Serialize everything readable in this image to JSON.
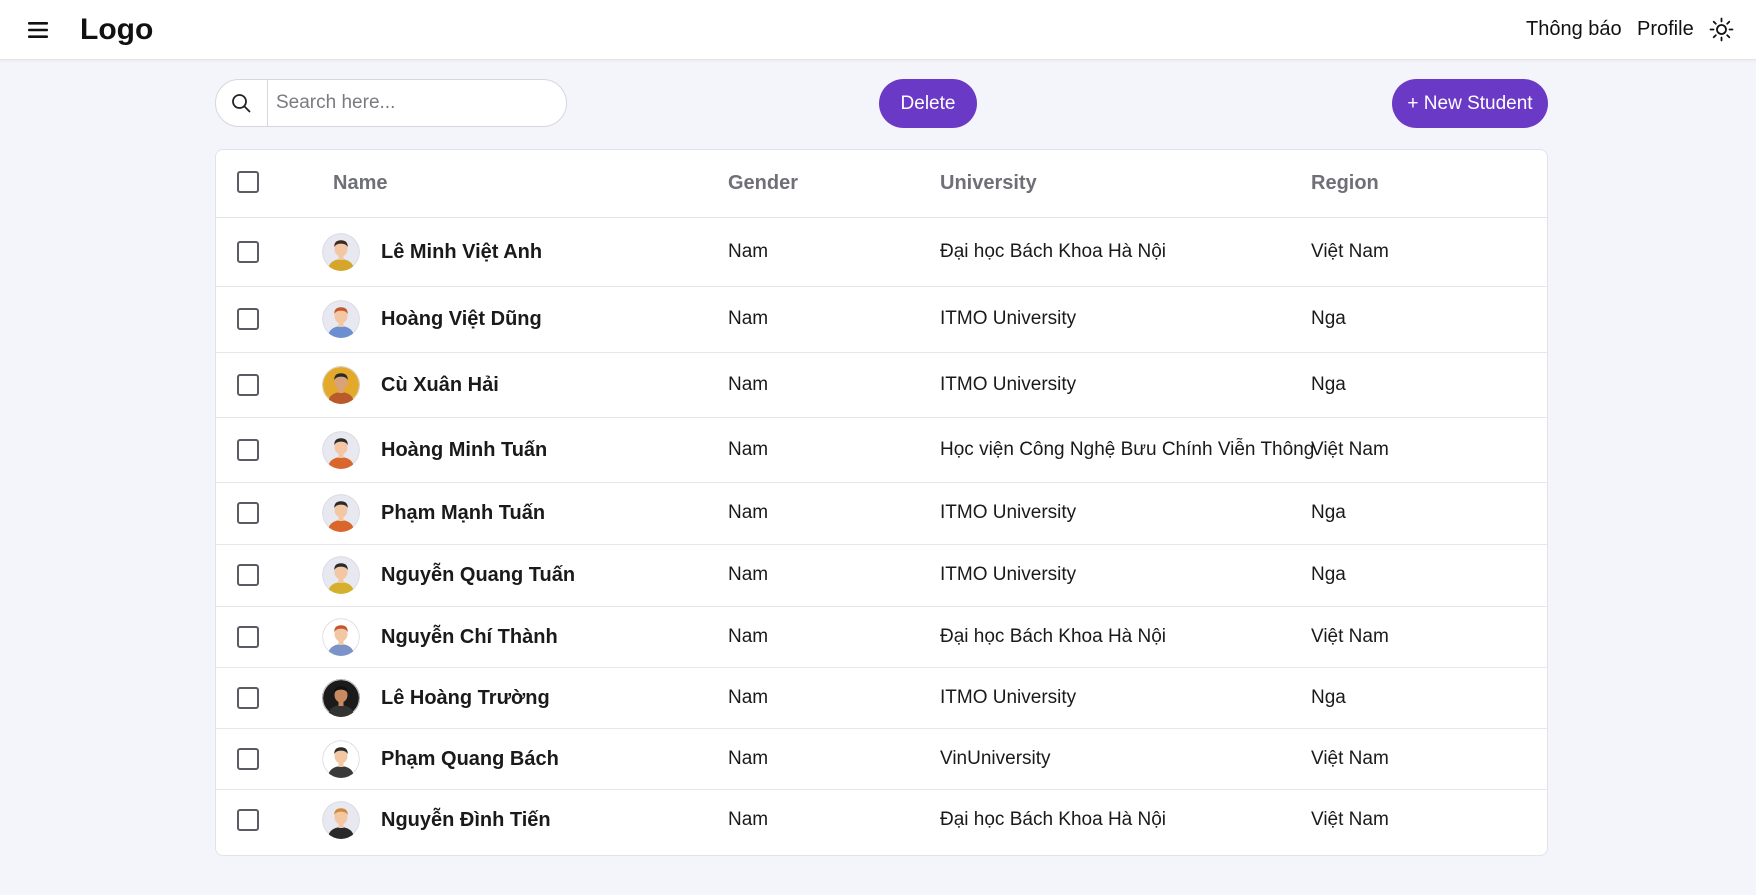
{
  "header": {
    "logo": "Logo",
    "nav": {
      "notifications": "Thông báo",
      "profile": "Profile"
    },
    "icons": {
      "menu": "hamburger-menu-icon",
      "theme": "sun-icon"
    }
  },
  "toolbar": {
    "search_placeholder": "Search here...",
    "search_value": "",
    "delete_label": "Delete",
    "new_label": "+ New Student"
  },
  "colors": {
    "accent": "#6a39c6",
    "background": "#f4f4fb"
  },
  "table": {
    "columns": {
      "name": "Name",
      "gender": "Gender",
      "university": "University",
      "region": "Region"
    },
    "rows": [
      {
        "name": "Lê Minh Việt Anh",
        "gender": "Nam",
        "university": "Đại học Bách Khoa Hà Nội",
        "region": "Việt Nam",
        "avatar": {
          "bg": "#e8e8f0",
          "skin": "#f3c7a3",
          "hair": "#3a2a20",
          "shirt": "#d4a72c"
        }
      },
      {
        "name": "Hoàng Việt Dũng",
        "gender": "Nam",
        "university": "ITMO University",
        "region": "Nga",
        "avatar": {
          "bg": "#e8e8f0",
          "skin": "#f3c7a3",
          "hair": "#c8542a",
          "shirt": "#6c8fd1"
        }
      },
      {
        "name": "Cù Xuân Hải",
        "gender": "Nam",
        "university": "ITMO University",
        "region": "Nga",
        "avatar": {
          "bg": "#e3a92a",
          "skin": "#d9a37a",
          "hair": "#2a2a2a",
          "shirt": "#b85a2a"
        }
      },
      {
        "name": "Hoàng Minh Tuấn",
        "gender": "Nam",
        "university": "Học viện Công Nghệ Bưu Chính Viễn Thông",
        "region": "Việt Nam",
        "avatar": {
          "bg": "#e8e8f0",
          "skin": "#f3c7a3",
          "hair": "#2a2a2a",
          "shirt": "#d9662a"
        }
      },
      {
        "name": "Phạm Mạnh Tuấn",
        "gender": "Nam",
        "university": "ITMO University",
        "region": "Nga",
        "avatar": {
          "bg": "#e8e8f0",
          "skin": "#f3c7a3",
          "hair": "#2a2a2a",
          "shirt": "#d9662a"
        }
      },
      {
        "name": "Nguyễn Quang Tuấn",
        "gender": "Nam",
        "university": "ITMO University",
        "region": "Nga",
        "avatar": {
          "bg": "#e8e8f0",
          "skin": "#f3c7a3",
          "hair": "#2a2a2a",
          "shirt": "#d4b02c"
        }
      },
      {
        "name": "Nguyễn Chí Thành",
        "gender": "Nam",
        "university": "Đại học Bách Khoa Hà Nội",
        "region": "Việt Nam",
        "avatar": {
          "bg": "#ffffff",
          "skin": "#f3c7a3",
          "hair": "#c8542a",
          "shirt": "#7b93c9"
        }
      },
      {
        "name": "Lê Hoàng Trường",
        "gender": "Nam",
        "university": "ITMO University",
        "region": "Nga",
        "avatar": {
          "bg": "#1b1b1b",
          "skin": "#c98a62",
          "hair": "#111111",
          "shirt": "#333333"
        }
      },
      {
        "name": "Phạm Quang Bách",
        "gender": "Nam",
        "university": "VinUniversity",
        "region": "Việt Nam",
        "avatar": {
          "bg": "#ffffff",
          "skin": "#f3c7a3",
          "hair": "#2a2a2a",
          "shirt": "#3a3a3a"
        }
      },
      {
        "name": "Nguyễn Đình Tiến",
        "gender": "Nam",
        "university": "Đại học Bách Khoa Hà Nội",
        "region": "Việt Nam",
        "avatar": {
          "bg": "#e8e8f0",
          "skin": "#f3c7a3",
          "hair": "#d08a3a",
          "shirt": "#2a2a2a"
        }
      }
    ]
  }
}
